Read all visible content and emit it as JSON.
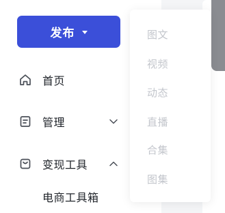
{
  "publish": {
    "label": "发布",
    "caret_icon": "caret-down-icon",
    "color": "#3b4fd9"
  },
  "sidebar": {
    "items": [
      {
        "label": "首页",
        "icon": "home-icon"
      },
      {
        "label": "管理",
        "icon": "document-icon",
        "chevron": "chevron-down-icon"
      },
      {
        "label": "变现工具",
        "icon": "shopping-bag-icon",
        "chevron": "chevron-up-icon",
        "expanded": true
      }
    ],
    "sub_items": [
      {
        "label": "电商工具箱"
      }
    ]
  },
  "publish_menu": {
    "items": [
      {
        "label": "图文"
      },
      {
        "label": "视频"
      },
      {
        "label": "动态"
      },
      {
        "label": "直播"
      },
      {
        "label": "合集"
      },
      {
        "label": "图集"
      }
    ],
    "text_color": "#c3c6cc"
  }
}
